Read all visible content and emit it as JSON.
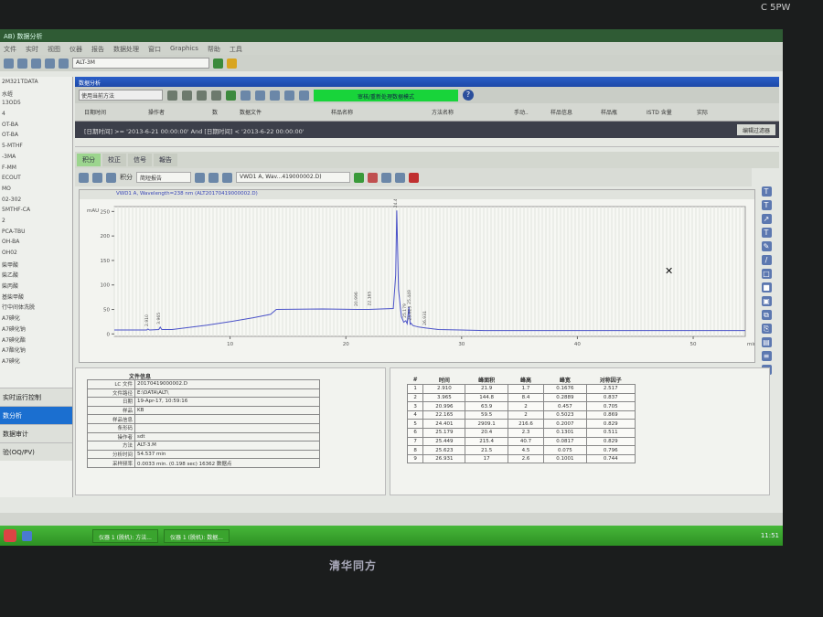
{
  "window": {
    "title": "AB) 数据分析",
    "brand": "C 5PW"
  },
  "menu": [
    "文件",
    "实时",
    "视图",
    "仪器",
    "报告",
    "数据处理",
    "窗口",
    "Graphics",
    "帮助",
    "工具"
  ],
  "toolbar1": {
    "search_value": "ALT-3M"
  },
  "sidebar": {
    "items": [
      "2M321TDATA",
      "水蛭",
      "13OD5",
      "4",
      "OT-BA",
      "OT-BA",
      "5-MTHF",
      "-3MA",
      "F-MM",
      "ECOUT",
      "MO",
      "02-302",
      "5MTHF-CA",
      "2",
      "PCA-TBU",
      "OH-BA",
      "OH02",
      "柴甲酸",
      "柴乙酸",
      "柴丙酸",
      "基柴甲酸",
      "行中间体洗脱",
      "A7碘化",
      "A7碘化钠",
      "A7碘化酯",
      "A7酯化钠",
      "A7碘化"
    ],
    "nav": [
      "实时运行控制",
      "数分析",
      "数据审计",
      "验(OQ/PV)"
    ]
  },
  "panel": {
    "title": "数据分析",
    "method_select": "使用当前方法",
    "status_box": "审核/重新处理数据模式",
    "columns": [
      "日期时间",
      "操作者",
      "数",
      "数据文件",
      "样品名称",
      "方法名称",
      "手动..",
      "样品信息",
      "样品瓶",
      "ISTD 含量",
      "实际"
    ],
    "filter": "[日期时间] >= '2013-6-21 00:00:00' And [日期时间] < '2013-6-22 00:00:00'",
    "filter_button": "编辑过滤器"
  },
  "tabs": [
    "积分",
    "校正",
    "信号",
    "報告"
  ],
  "toolbar3": {
    "label": "积分",
    "preset": "简短报告",
    "signal_select": "VWD1 A, Wav...419000002.D)"
  },
  "chart_data": {
    "type": "line",
    "title": "VWD1 A, Wavelength=238 nm (ALT20170419000002.D)",
    "ylabel": "mAU",
    "xlabel": "min",
    "xlim": [
      0,
      54.5
    ],
    "ylim": [
      -5,
      260
    ],
    "xticks": [
      10,
      20,
      30,
      40,
      50
    ],
    "yticks": [
      0,
      50,
      100,
      150,
      200,
      250
    ],
    "x": [
      0,
      2.8,
      2.91,
      3.05,
      3.85,
      3.965,
      4.1,
      5,
      8,
      10,
      12,
      13.5,
      14,
      18,
      21,
      22,
      24.1,
      24.3,
      24.4,
      24.55,
      24.8,
      25.0,
      25.18,
      25.3,
      25.45,
      25.55,
      25.62,
      25.8,
      26.3,
      26.93,
      28,
      32,
      54.5
    ],
    "y": [
      8,
      8,
      10,
      8,
      9,
      14,
      9,
      9,
      18,
      25,
      33,
      40,
      50,
      51,
      50,
      50,
      52,
      120,
      252,
      90,
      35,
      24,
      27,
      21,
      55,
      20,
      22,
      17,
      14,
      12,
      9,
      7,
      7
    ],
    "peak_labels": [
      "2.910",
      "3.965",
      "20.996",
      "22.165",
      "24.401",
      "25.179",
      "25.449",
      "25.623",
      "26.931"
    ]
  },
  "file_info": {
    "title": "文件信息",
    "rows": [
      [
        "LC 文件",
        "20170419000002.D"
      ],
      [
        "文件路径",
        "E:\\DATA\\ALT\\"
      ],
      [
        "日期",
        "19-Apr-17, 10:59:16"
      ],
      [
        "样品",
        "KB"
      ],
      [
        "样品信息",
        ""
      ],
      [
        "条形码",
        ""
      ],
      [
        "操作者",
        "sdt"
      ],
      [
        "方法",
        "ALT-3.M"
      ],
      [
        "分析时间",
        "54.537 min"
      ],
      [
        "采样频率",
        "0.0033 min. (0.198 sec)  16362 数据点"
      ]
    ]
  },
  "peak_table": {
    "headers": [
      "#",
      "时间",
      "峰面积",
      "峰高",
      "峰宽",
      "对称因子"
    ],
    "rows": [
      [
        "1",
        "2.910",
        "21.9",
        "1.7",
        "0.1676",
        "2.517"
      ],
      [
        "2",
        "3.965",
        "144.8",
        "8.4",
        "0.2889",
        "0.837"
      ],
      [
        "3",
        "20.996",
        "63.9",
        "2",
        "0.457",
        "0.705"
      ],
      [
        "4",
        "22.165",
        "59.5",
        "2",
        "0.5023",
        "0.869"
      ],
      [
        "5",
        "24.401",
        "2909.1",
        "216.6",
        "0.2007",
        "0.829"
      ],
      [
        "6",
        "25.179",
        "20.4",
        "2.3",
        "0.1301",
        "0.511"
      ],
      [
        "7",
        "25.449",
        "215.4",
        "40.7",
        "0.0817",
        "0.829"
      ],
      [
        "8",
        "25.623",
        "21.5",
        "4.5",
        "0.075",
        "0.796"
      ],
      [
        "9",
        "26.931",
        "17",
        "2.6",
        "0.1001",
        "0.744"
      ]
    ]
  },
  "taskbar": {
    "tasks": [
      "仪器 1 (脱机): 方法...",
      "仪器 1 (脱机): 数据..."
    ],
    "clock": "11:51"
  },
  "bezel": {
    "logo": "清华同方"
  }
}
